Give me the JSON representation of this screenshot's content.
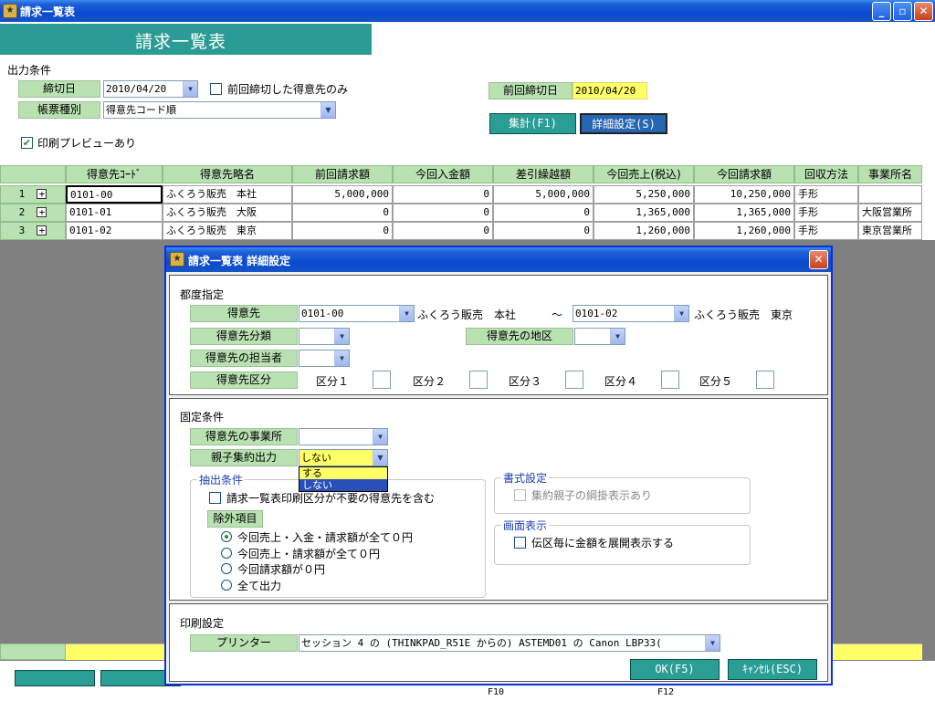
{
  "window": {
    "title": "請求一覧表",
    "min": "_",
    "max": "▫",
    "close": "✕"
  },
  "header": {
    "title": "請求一覧表"
  },
  "output": {
    "section_label": "出力条件",
    "closing_date_label": "締切日",
    "closing_date_value": "2010/04/20",
    "prev_closing_only_label": "前回締切した得意先のみ",
    "report_type_label": "帳票種別",
    "report_type_value": "得意先コード順",
    "print_preview_label": "印刷プレビューあり",
    "prev_closing_date_label": "前回締切日",
    "prev_closing_date_value": "2010/04/20",
    "tally_button": "集計(F1)",
    "detail_button": "詳細設定(S)"
  },
  "table": {
    "columns": [
      "得意先ｺｰﾄﾞ",
      "得意先略名",
      "前回請求額",
      "今回入金額",
      "差引繰越額",
      "今回売上(税込)",
      "今回請求額",
      "回収方法",
      "事業所名"
    ],
    "rows": [
      {
        "no": "1",
        "code": "0101-00",
        "name": "ふくろう販売　本社",
        "prev": "5,000,000",
        "paid": "0",
        "carry": "5,000,000",
        "sales": "5,250,000",
        "bill": "10,250,000",
        "method": "手形",
        "office": ""
      },
      {
        "no": "2",
        "code": "0101-01",
        "name": "ふくろう販売　大阪",
        "prev": "0",
        "paid": "0",
        "carry": "0",
        "sales": "1,365,000",
        "bill": "1,365,000",
        "method": "手形",
        "office": "大阪営業所"
      },
      {
        "no": "3",
        "code": "0101-02",
        "name": "ふくろう販売　東京",
        "prev": "0",
        "paid": "0",
        "carry": "0",
        "sales": "1,260,000",
        "bill": "1,260,000",
        "method": "手形",
        "office": "東京営業所"
      }
    ]
  },
  "footer": {
    "f10": "F10",
    "f12": "F12"
  },
  "dialog": {
    "title": "請求一覧表 詳細設定",
    "close": "✕",
    "each_time": {
      "label": "都度指定",
      "customer_label": "得意先",
      "customer_from": "0101-00",
      "customer_from_name": "ふくろう販売　本社",
      "tilde": "〜",
      "customer_to": "0101-02",
      "customer_to_name": "ふくろう販売　東京",
      "category_label": "得意先分類",
      "region_label": "得意先の地区",
      "staff_label": "得意先の担当者",
      "division_label": "得意先区分",
      "divisions": [
        "区分１",
        "区分２",
        "区分３",
        "区分４",
        "区分５"
      ]
    },
    "fixed": {
      "label": "固定条件",
      "office_label": "得意先の事業所",
      "parent_agg_label": "親子集約出力",
      "parent_agg_value": "しない",
      "parent_agg_options": [
        "する",
        "しない"
      ],
      "extract_legend": "抽出条件",
      "include_unneeded_label": "請求一覧表印刷区分が不要の得意先を含む",
      "exclude_label": "除外項目",
      "radios": [
        "今回売上・入金・請求額が全て０円",
        "今回売上・請求額が全て０円",
        "今回請求額が０円",
        "全て出力"
      ],
      "format_legend": "書式設定",
      "net_display_label": "集約親子の綱掛表示あり",
      "screen_legend": "画面表示",
      "expand_label": "伝区毎に金額を展開表示する"
    },
    "print": {
      "label": "印刷設定",
      "printer_label": "プリンター",
      "printer_value": "セッション 4 の (THINKPAD_R51E からの) ASTEMD01 の Canon LBP33("
    },
    "ok_button": "OK(F5)",
    "cancel_button": "ｷｬﾝｾﾙ(ESC)"
  }
}
